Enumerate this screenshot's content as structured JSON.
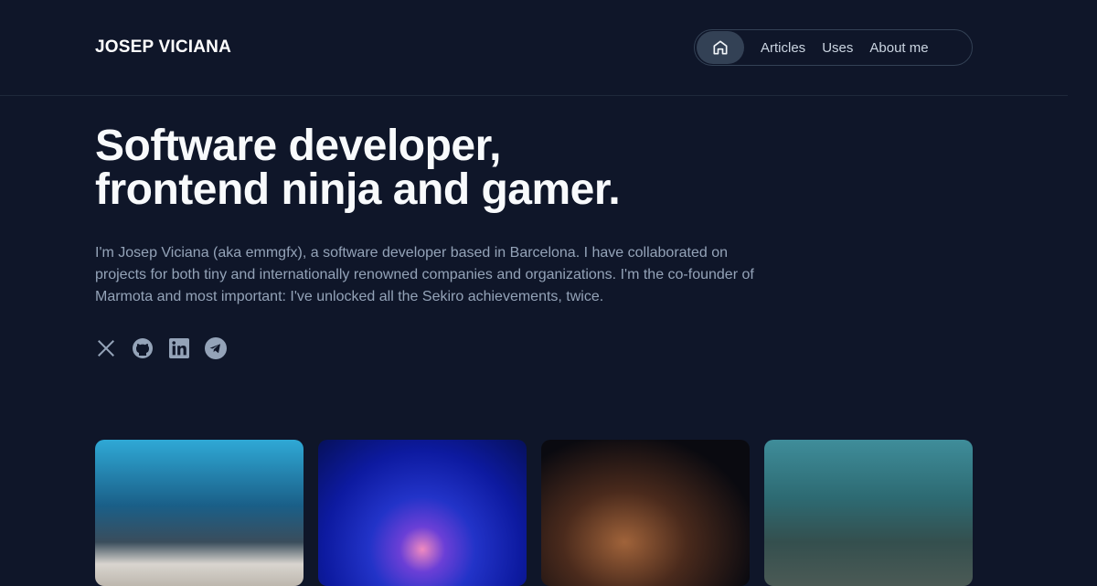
{
  "header": {
    "logo": "JOSEP VICIANA",
    "nav": [
      {
        "label": "Articles"
      },
      {
        "label": "Uses"
      },
      {
        "label": "About me"
      }
    ],
    "home_icon": "home-icon"
  },
  "hero": {
    "title_line1": "Software developer,",
    "title_line2": "frontend ninja and gamer.",
    "intro": "I'm Josep Viciana (aka emmgfx), a software developer based in Barcelona. I have collaborated on projects for both tiny and internationally renowned companies and organizations. I'm the co-founder of Marmota and most important: I've unlocked all the Sekiro achievements, twice."
  },
  "social": [
    "x-icon",
    "github-icon",
    "linkedin-icon",
    "telegram-icon"
  ],
  "photos": [
    "gamepad",
    "neon tunnel",
    "city at night",
    "catfish aquarium"
  ],
  "colors": {
    "background": "#0f1629",
    "text_muted": "#94a3b8",
    "icon": "#94a3b8"
  }
}
